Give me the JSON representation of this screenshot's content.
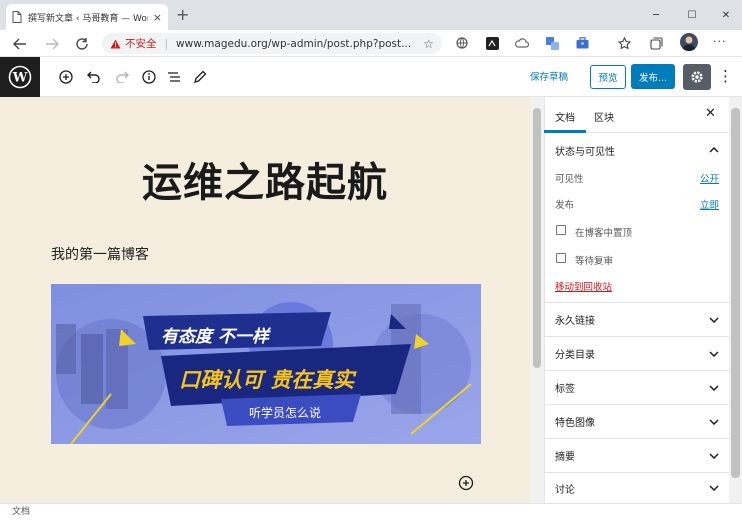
{
  "browser": {
    "tab_title": "撰写新文章 ‹ 马哥教育 — WordPress",
    "tab_close": "×",
    "new_tab": "+",
    "security_label": "不安全",
    "url": "www.magedu.org/wp-admin/post.php?post...",
    "bookmark_star": "☆",
    "menu_dots": "···",
    "window_buttons": [
      "─",
      "☐",
      "✕"
    ]
  },
  "wp_toolbar": {
    "save_draft": "保存草稿",
    "preview": "预览",
    "publish": "发布...",
    "more": "⋮"
  },
  "editor": {
    "post_title": "运维之路起航",
    "paragraph": "我的第一篇博客",
    "banner": {
      "line1": "有态度 不一样",
      "line2": "口碑认可 贵在真实",
      "line3": "听学员怎么说"
    }
  },
  "sidebar": {
    "tabs": [
      "文档",
      "区块"
    ],
    "close": "✕",
    "status_panel": {
      "title": "状态与可见性",
      "visibility_label": "可见性",
      "visibility_value": "公开",
      "publish_label": "发布",
      "publish_value": "立即",
      "sticky_label": "在博客中置顶",
      "pending_label": "等待复审",
      "trash_label": "移动到回收站"
    },
    "panels": [
      "永久链接",
      "分类目录",
      "标签",
      "特色图像",
      "摘要",
      "讨论"
    ]
  },
  "statusbar": {
    "breadcrumb": "文档"
  },
  "colors": {
    "accent": "#007cba",
    "editor_bg": "#f5eddd",
    "danger": "#cc1818",
    "wp_dark": "#1e1e1e"
  }
}
